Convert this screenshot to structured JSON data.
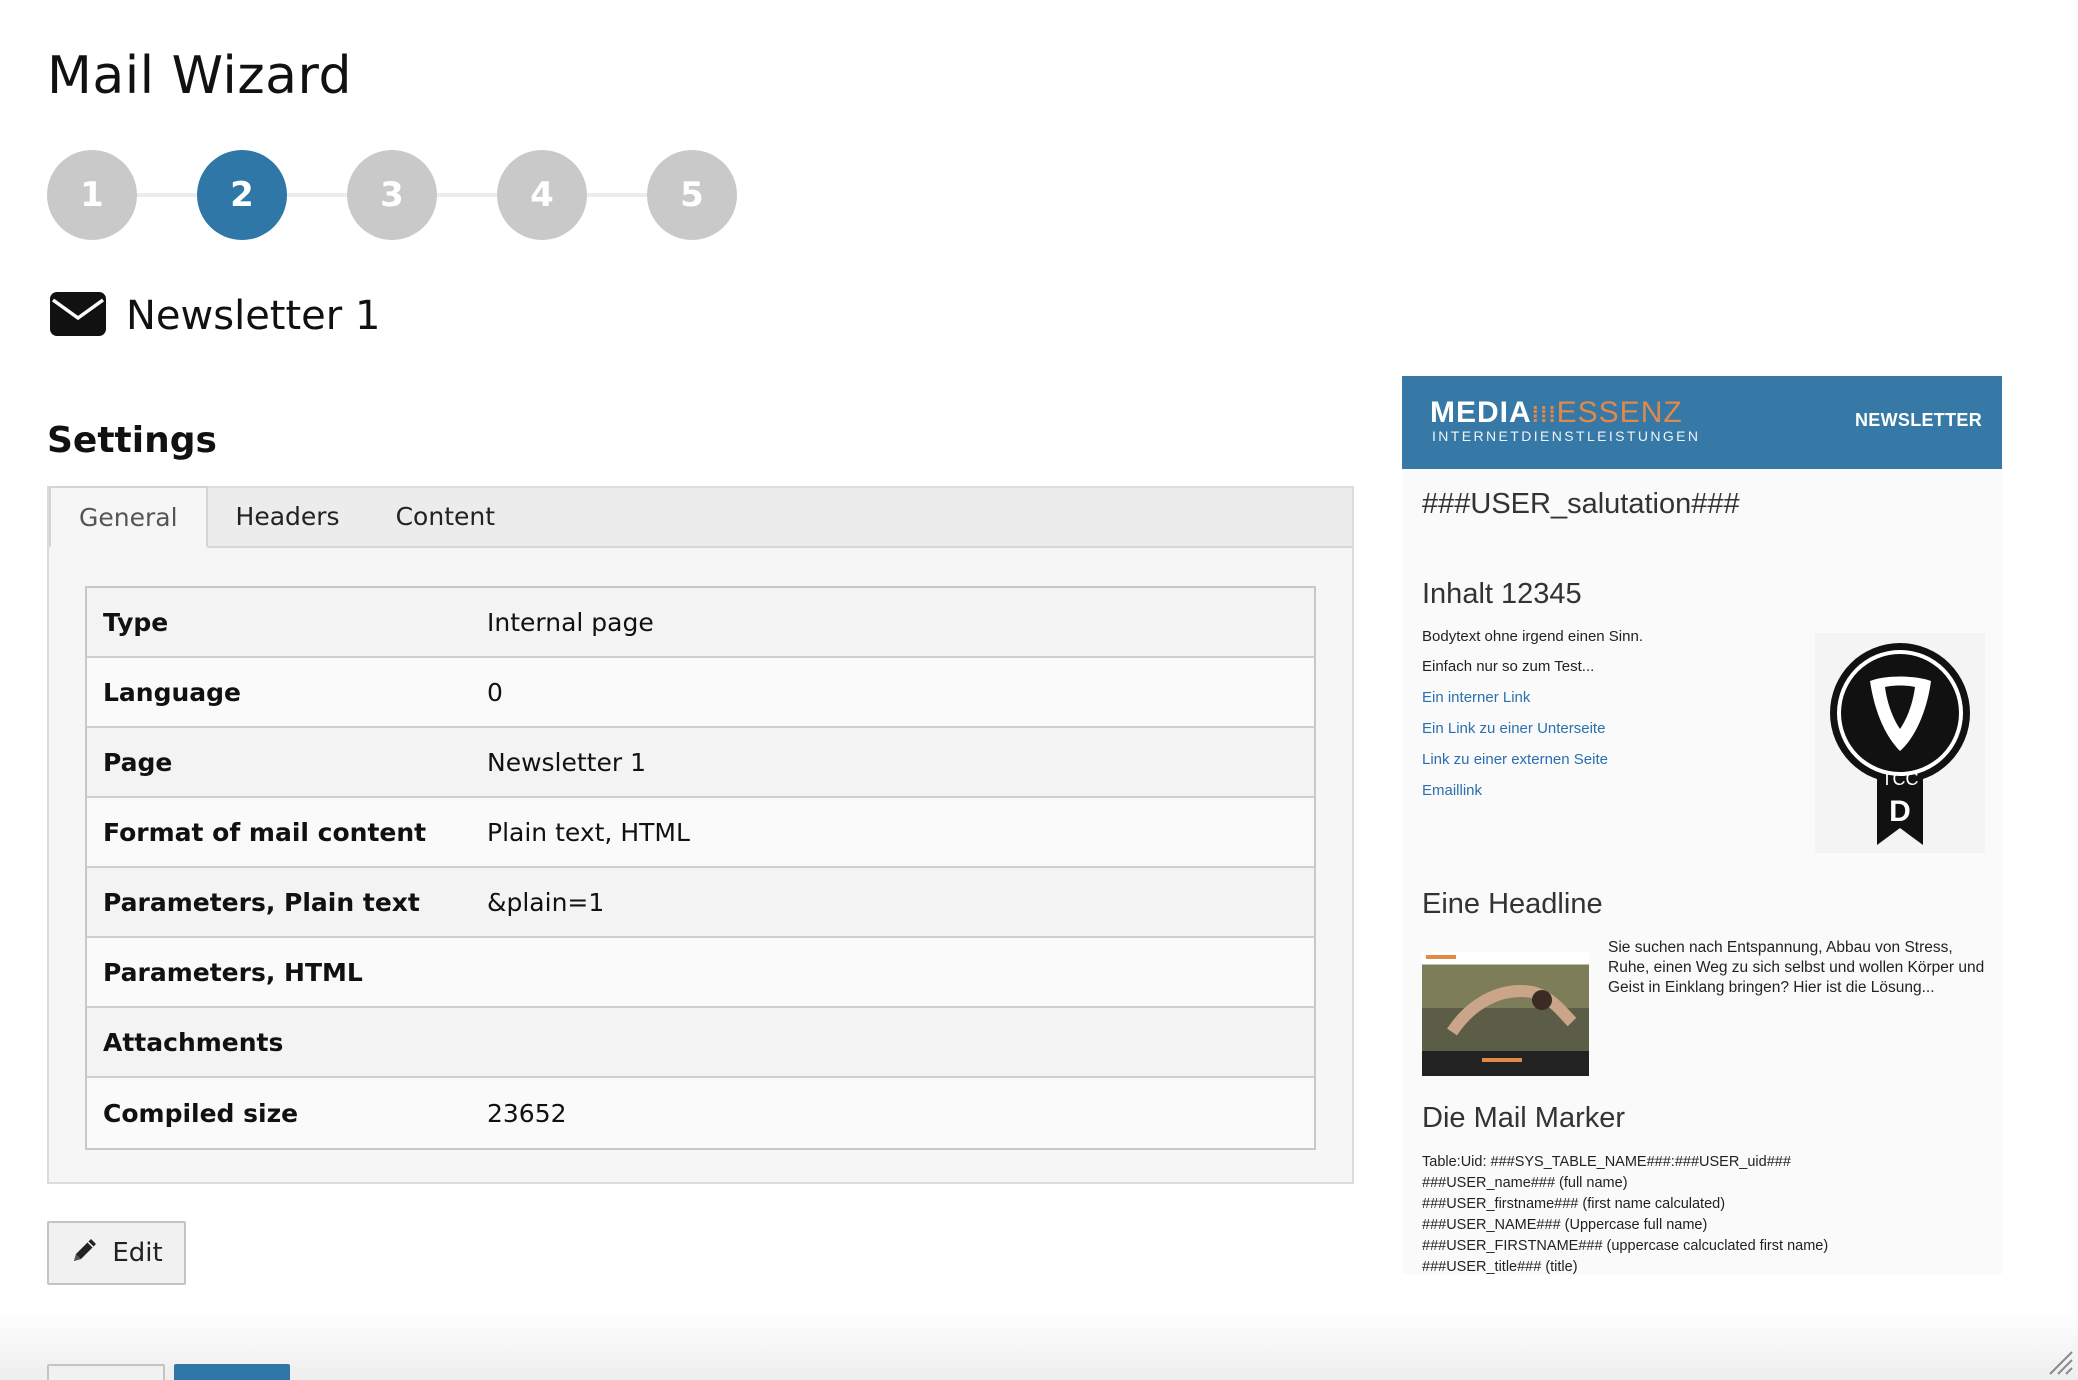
{
  "page": {
    "title": "Mail Wizard"
  },
  "stepper": {
    "steps": [
      "1",
      "2",
      "3",
      "4",
      "5"
    ],
    "active_step": "2"
  },
  "mail": {
    "icon": "envelope-icon",
    "title": "Newsletter 1"
  },
  "settings": {
    "title": "Settings",
    "tabs": [
      "General",
      "Headers",
      "Content"
    ],
    "active_tab": "General",
    "rows": [
      {
        "key": "Type",
        "value": "Internal page"
      },
      {
        "key": "Language",
        "value": "0"
      },
      {
        "key": "Page",
        "value": "Newsletter 1"
      },
      {
        "key": "Format of mail content",
        "value": "Plain text, HTML"
      },
      {
        "key": "Parameters, Plain text",
        "value": "&plain=1"
      },
      {
        "key": "Parameters, HTML",
        "value": ""
      },
      {
        "key": "Attachments",
        "value": ""
      },
      {
        "key": "Compiled size",
        "value": "23652"
      }
    ],
    "edit_label": "Edit"
  },
  "preview": {
    "brand_bold": "MEDIA",
    "brand_light": "ESSENZ",
    "tagline": "INTERNETDIENSTLEISTUNGEN",
    "newsletter_label": "NEWSLETTER",
    "salutation": "###USER_salutation###",
    "section1": {
      "heading": "Inhalt 12345",
      "text1": "Bodytext ohne irgend einen Sinn.",
      "text2": "Einfach nur so zum Test...",
      "links": [
        "Ein interner Link",
        "Ein Link zu einer Unterseite",
        "Link zu einer externen Seite",
        "Emaillink"
      ],
      "badge_text": "TCC",
      "badge_letter": "D"
    },
    "section2": {
      "heading": "Eine Headline",
      "text": "Sie suchen nach Entspannung, Abbau von Stress, Ruhe, einen Weg zu sich selbst und wollen Körper und Geist in Einklang bringen? Hier ist die Lösung..."
    },
    "section3": {
      "heading": "Die Mail Marker",
      "lines": [
        "Table:Uid: ###SYS_TABLE_NAME###:###USER_uid###",
        "###USER_name### (full name)",
        "###USER_firstname### (first name calculated)",
        "###USER_NAME### (Uppercase full name)",
        "###USER_FIRSTNAME### (uppercase calcuclated first name)",
        "###USER_title### (title)"
      ]
    }
  },
  "colors": {
    "accent": "#2f77a6",
    "step_inactive": "#c9c9c9",
    "preview_header": "#3678a6",
    "link": "#2a6fb0"
  }
}
